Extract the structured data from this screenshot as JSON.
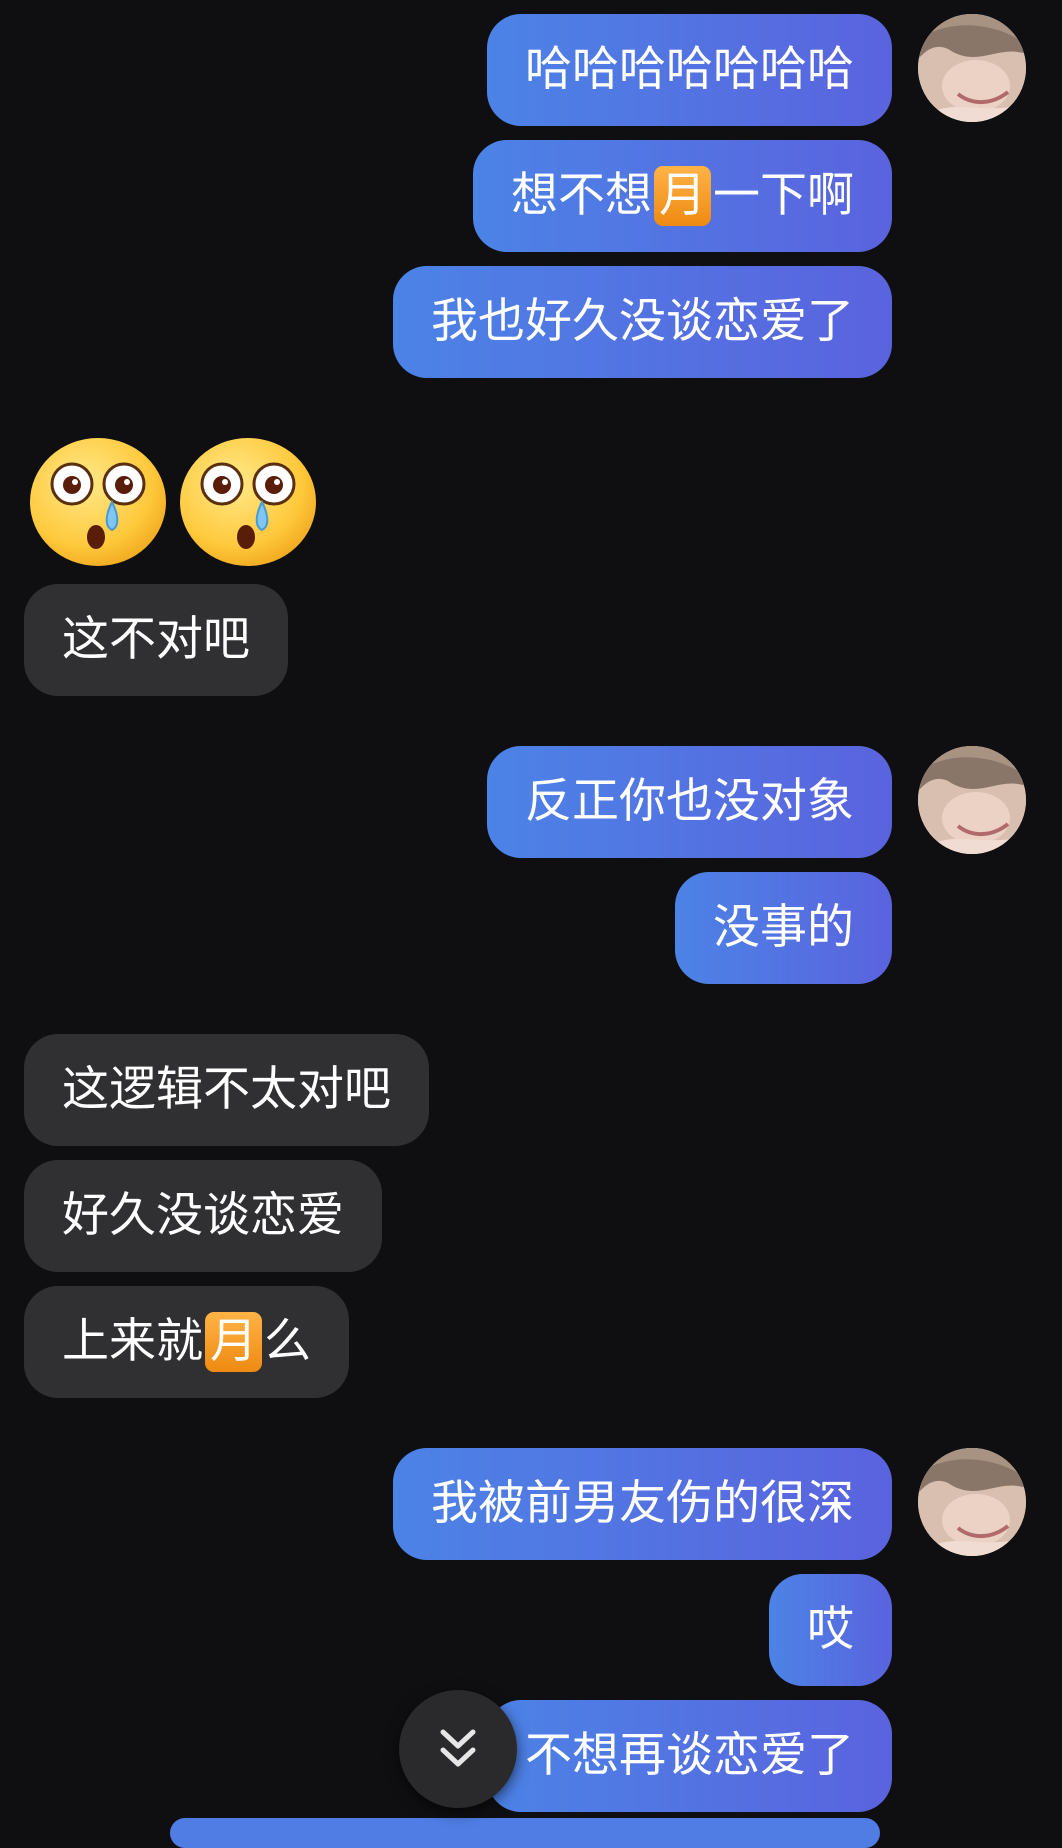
{
  "colors": {
    "background": "#0f0f11",
    "outgoing_start": "#5a63de",
    "outgoing_end": "#4c83e6",
    "incoming": "#303032",
    "highlight": "#f5a23a"
  },
  "messages": [
    {
      "id": "m1",
      "side": "out",
      "text": "哈哈哈哈哈哈哈",
      "avatar": true
    },
    {
      "id": "m2",
      "side": "out",
      "before": "想不想",
      "highlight": "月",
      "after": "一下啊"
    },
    {
      "id": "m3",
      "side": "out",
      "text": "我也好久没谈恋爱了"
    },
    {
      "id": "m4",
      "side": "in",
      "sticker": [
        "crying-surprised-face-emoji",
        "crying-surprised-face-emoji"
      ]
    },
    {
      "id": "m5",
      "side": "in",
      "text": "这不对吧"
    },
    {
      "id": "m6",
      "side": "out",
      "text": "反正你也没对象",
      "avatar": true
    },
    {
      "id": "m7",
      "side": "out",
      "text": "没事的"
    },
    {
      "id": "m8",
      "side": "in",
      "text": "这逻辑不太对吧"
    },
    {
      "id": "m9",
      "side": "in",
      "text": "好久没谈恋爱"
    },
    {
      "id": "m10",
      "side": "in",
      "before": "上来就",
      "highlight": "月",
      "after": "么"
    },
    {
      "id": "m11",
      "side": "out",
      "text": "我被前男友伤的很深",
      "avatar": true
    },
    {
      "id": "m12",
      "side": "out",
      "text": "哎"
    },
    {
      "id": "m13",
      "side": "out",
      "text": "不想再谈恋爱了"
    }
  ],
  "scroll_button": {
    "icon": "double-chevron-down-icon"
  }
}
